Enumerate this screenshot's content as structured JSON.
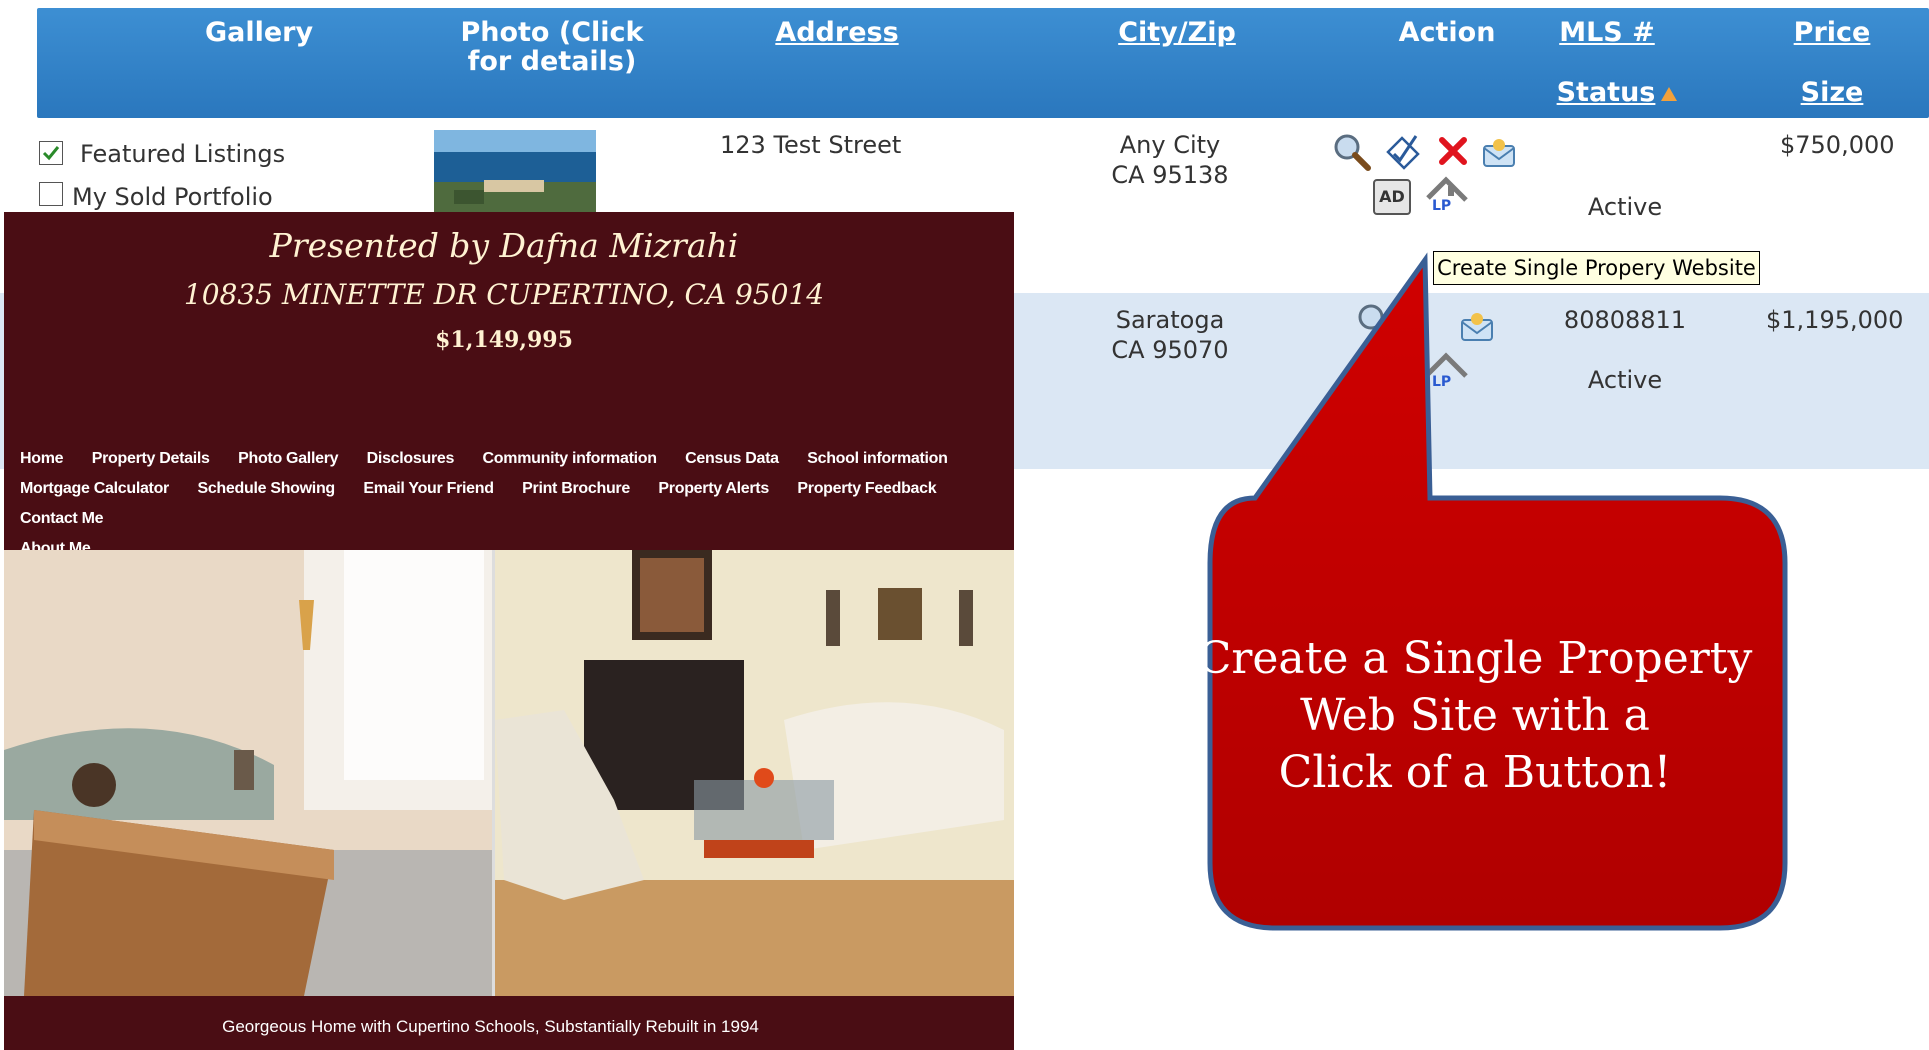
{
  "header": {
    "gallery": "Gallery",
    "photo": "Photo (Click for details)",
    "address": "Address",
    "city_zip": "City/Zip",
    "action": "Action",
    "mls": "MLS #",
    "status": "Status",
    "price": "Price",
    "size": "Size"
  },
  "gallery_options": [
    {
      "label": "Featured Listings",
      "checked": true
    },
    {
      "label": "My Sold Portfolio",
      "checked": false
    }
  ],
  "listings": [
    {
      "address": "123 Test Street",
      "city": "Any City",
      "zip": "CA 95138",
      "mls": "",
      "status": "Active",
      "price": "$750,000"
    },
    {
      "address": "",
      "city": "Saratoga",
      "zip": "CA 95070",
      "mls": "80808811",
      "status": "Active",
      "price": "$1,195,000"
    }
  ],
  "action_icons": [
    "magnifier-icon",
    "edit-icon",
    "delete-icon",
    "email-icon",
    "ad-icon",
    "single-property-site-icon"
  ],
  "ad_label": "AD",
  "tooltip": "Create Single Propery Website",
  "site": {
    "presented_by": "Presented by Dafna Mizrahi",
    "address": "10835 MINETTE DR CUPERTINO, CA 95014",
    "price": "$1,149,995",
    "nav": [
      "Home",
      "Property Details",
      "Photo Gallery",
      "Disclosures",
      "Community information",
      "Census Data",
      "School information",
      "Mortgage Calculator",
      "Schedule Showing",
      "Email Your Friend",
      "Print Brochure",
      "Property Alerts",
      "Property Feedback",
      "Contact Me",
      "About Me"
    ],
    "caption": "Georgeous Home with Cupertino Schools, Substantially Rebuilt in 1994"
  },
  "callout": {
    "line1": "Create a Single Property",
    "line2": "Web Site with a",
    "line3": "Click of a Button!"
  },
  "colors": {
    "header_blue": "#2f80c6",
    "row_alt": "#dbe7f4",
    "site_maroon": "#4a0d14",
    "callout_red": "#c00000"
  }
}
